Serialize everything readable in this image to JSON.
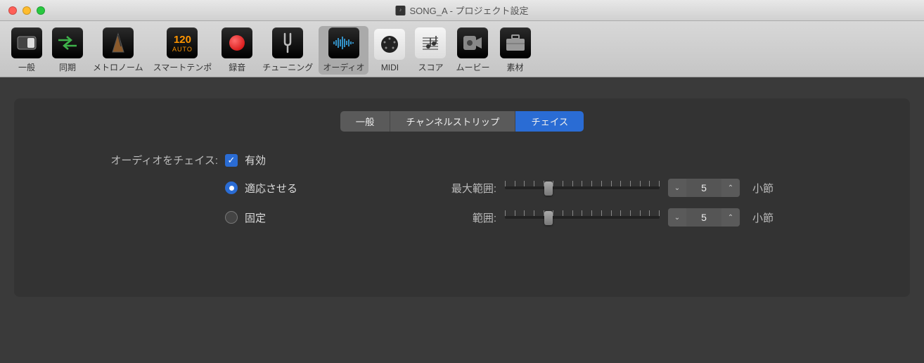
{
  "window": {
    "title": "SONG_A - プロジェクト設定"
  },
  "toolbar": {
    "items": [
      {
        "label": "一般",
        "icon": "switch"
      },
      {
        "label": "同期",
        "icon": "sync"
      },
      {
        "label": "メトロノーム",
        "icon": "metronome"
      },
      {
        "label": "スマートテンポ",
        "icon": "tempo",
        "badge": "120",
        "badge2": "AUTO"
      },
      {
        "label": "録音",
        "icon": "record"
      },
      {
        "label": "チューニング",
        "icon": "fork"
      },
      {
        "label": "オーディオ",
        "icon": "audio",
        "active": true
      },
      {
        "label": "MIDI",
        "icon": "midi"
      },
      {
        "label": "スコア",
        "icon": "score"
      },
      {
        "label": "ムービー",
        "icon": "movie"
      },
      {
        "label": "素材",
        "icon": "assets"
      }
    ]
  },
  "tabs": {
    "items": [
      "一般",
      "チャンネルストリップ",
      "チェイス"
    ],
    "activeIndex": 2
  },
  "form": {
    "chaseLabel": "オーディオをチェイス:",
    "enableLabel": "有効",
    "adaptLabel": "適応させる",
    "fixedLabel": "固定",
    "maxRangeLabel": "最大範囲:",
    "rangeLabel": "範囲:",
    "maxRangeValue": "5",
    "rangeValue": "5",
    "unitLabel": "小節",
    "mode": "adapt"
  }
}
